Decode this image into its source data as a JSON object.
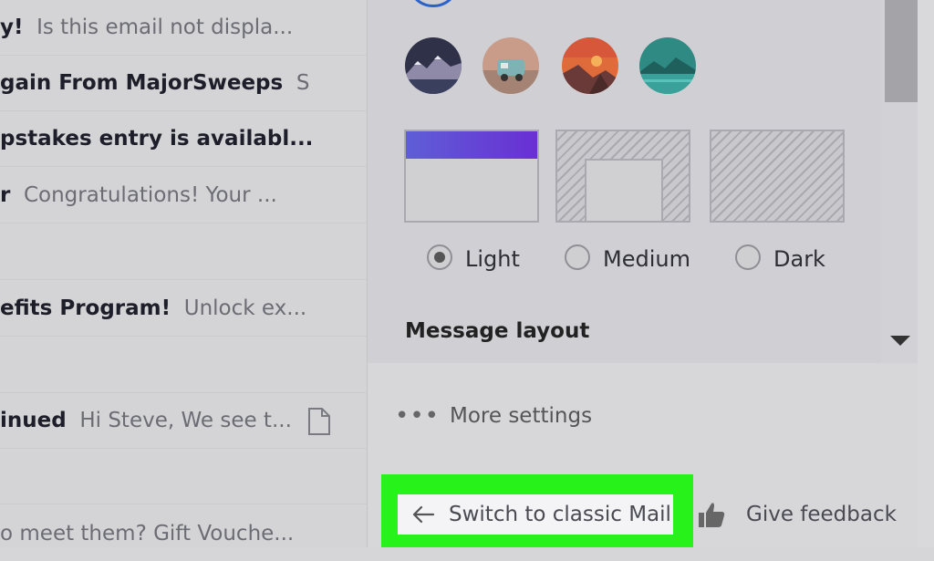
{
  "emails": [
    {
      "sender": "y!",
      "preview": "Is this email not displa..."
    },
    {
      "sender": "gain From MajorSweeps",
      "preview": "S"
    },
    {
      "sender": "pstakes entry is availabl...",
      "preview": ""
    },
    {
      "sender": "r",
      "preview": "Congratulations! Your ..."
    },
    {
      "sender": "",
      "preview": ""
    },
    {
      "sender": "efits Program!",
      "preview": "Unlock ex..."
    },
    {
      "sender": "",
      "preview": ""
    },
    {
      "sender": "inued",
      "preview": "Hi Steve, We see t..."
    },
    {
      "sender": "",
      "preview": ""
    },
    {
      "sender": "",
      "preview": "o meet them? Gift Vouche..."
    }
  ],
  "settings": {
    "themes": [
      "mountain-theme",
      "caravan-theme",
      "sunset-theme",
      "lake-theme"
    ],
    "themes_selected": "top-left circle",
    "theme_accent": "#2c63c8",
    "layout_cards": [
      "full-layout",
      "boxed-layout",
      "textured-layout"
    ],
    "modes": [
      {
        "label": "Light",
        "selected": true
      },
      {
        "label": "Medium",
        "selected": false
      },
      {
        "label": "Dark",
        "selected": false
      }
    ],
    "message_layout_title": "Message layout",
    "more_settings_label": "More settings",
    "switch_classic_label": "Switch to classic Mail",
    "feedback_label": "Give feedback",
    "highlight_color": "#27f21a"
  }
}
